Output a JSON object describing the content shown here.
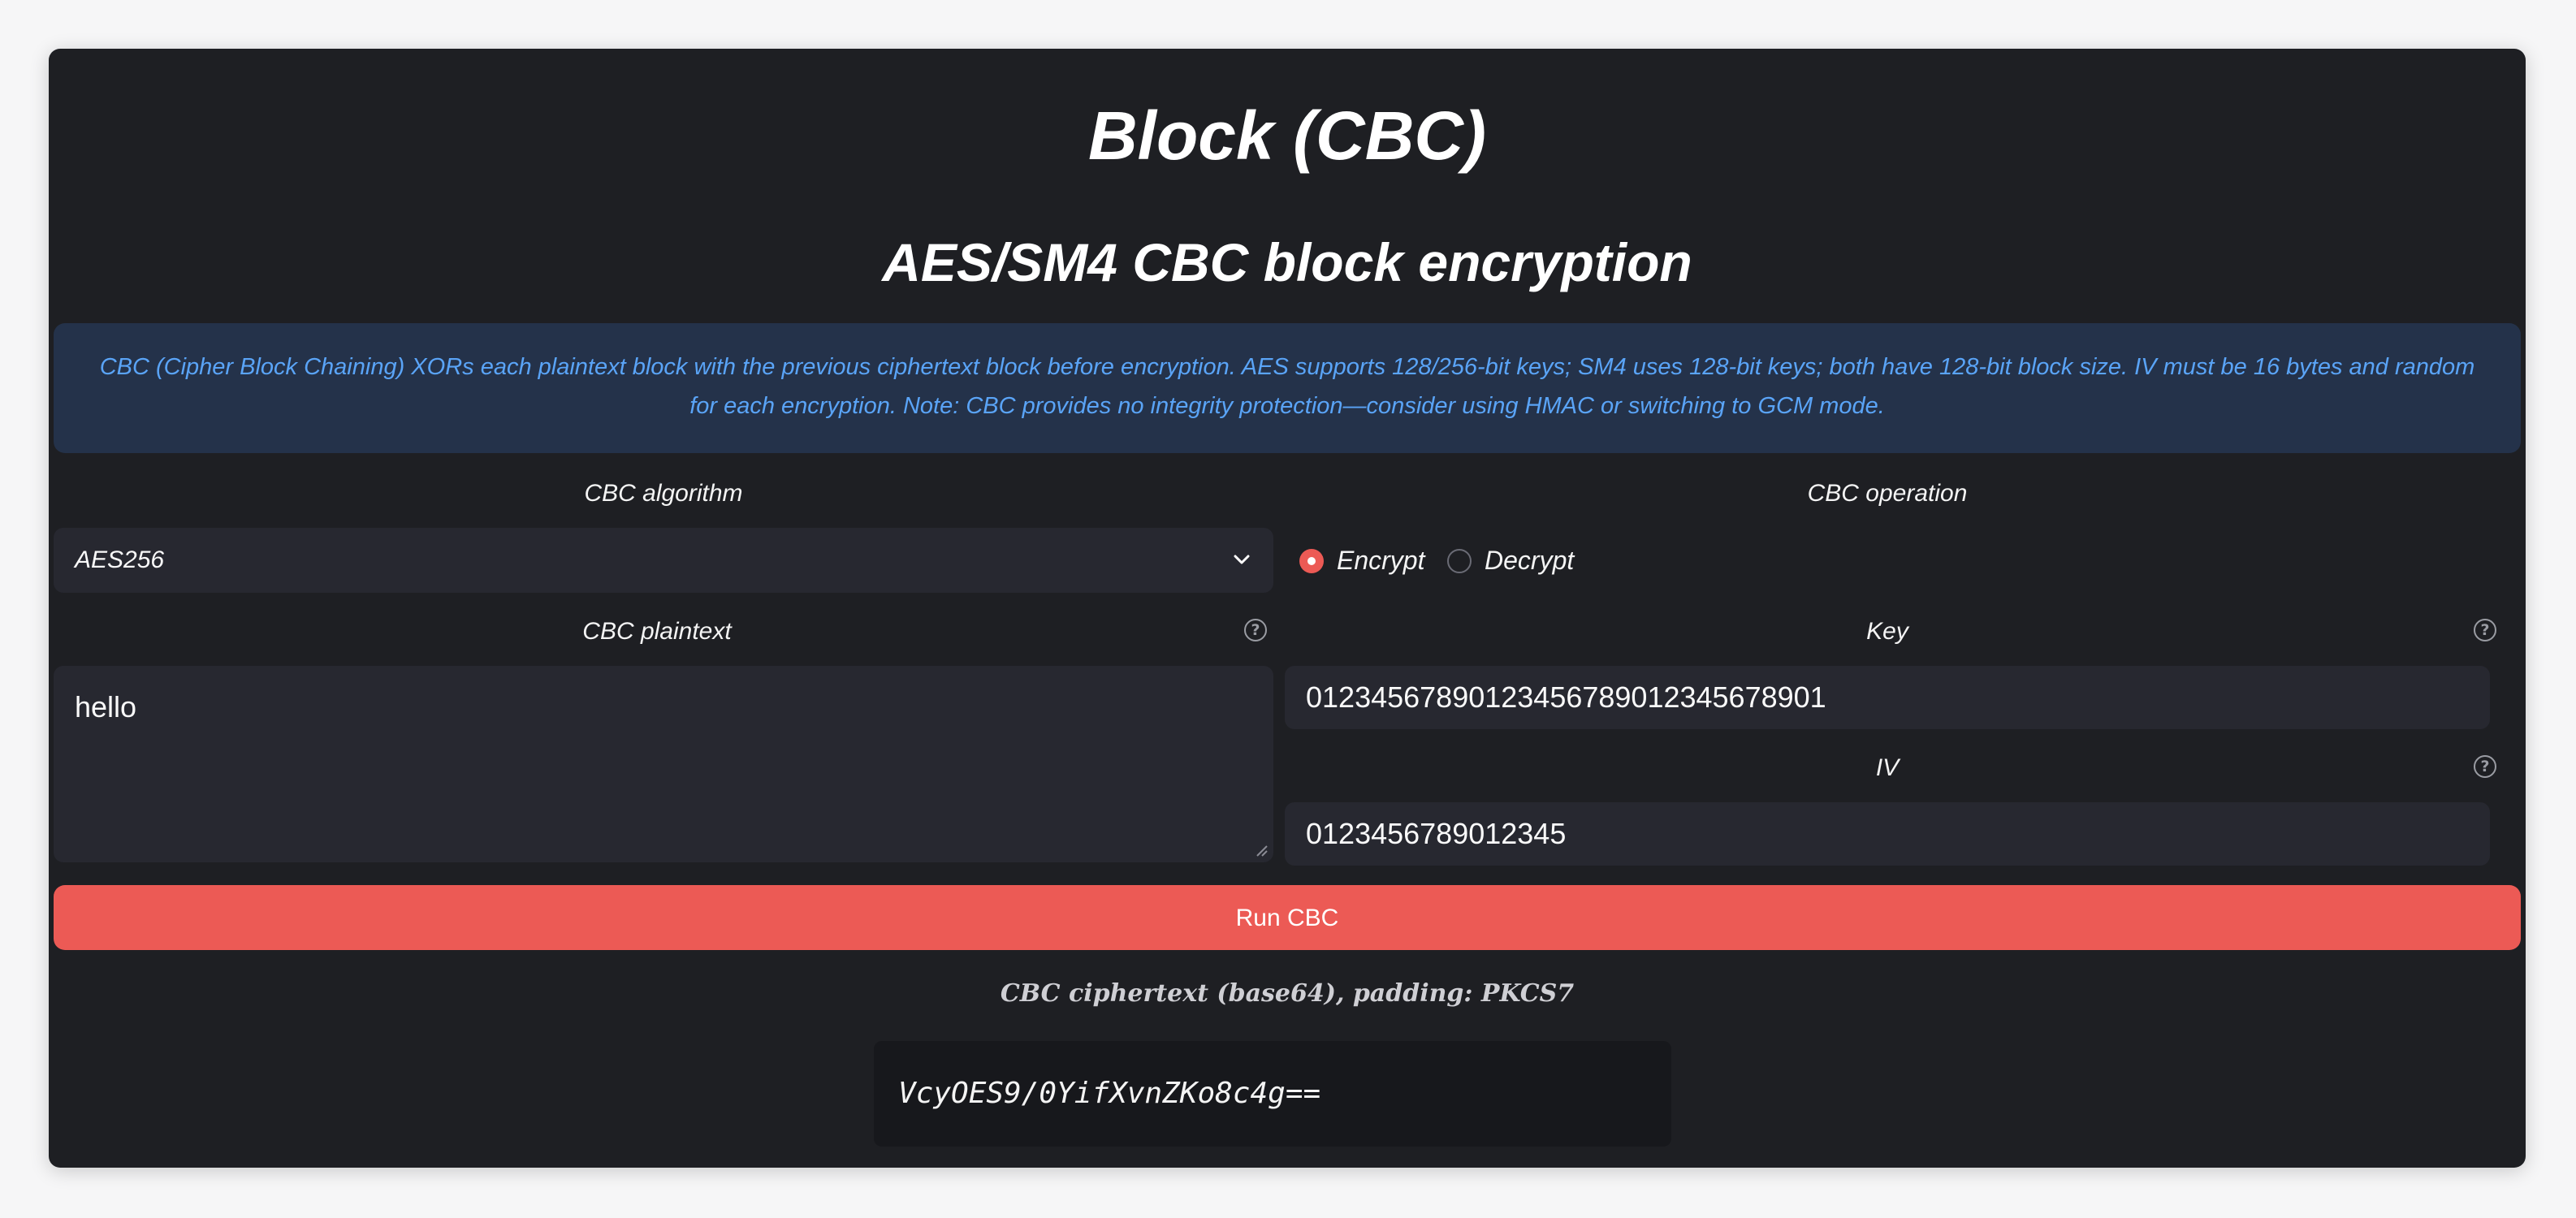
{
  "page": {
    "title": "Block (CBC)",
    "subtitle": "AES/SM4 CBC block encryption",
    "info": "CBC (Cipher Block Chaining) XORs each plaintext block with the previous ciphertext block before encryption. AES supports 128/256-bit keys; SM4 uses 128-bit keys; both have 128-bit block size. IV must be 16 bytes and random for each encryption. Note: CBC provides no integrity protection—consider using HMAC or switching to GCM mode."
  },
  "algorithm": {
    "label": "CBC algorithm",
    "selected": "AES256",
    "icon": "chevron-down-icon"
  },
  "operation": {
    "label": "CBC operation",
    "options": [
      {
        "label": "Encrypt",
        "selected": true
      },
      {
        "label": "Decrypt",
        "selected": false
      }
    ]
  },
  "plaintext": {
    "label": "CBC plaintext",
    "value": "hello",
    "help_icon": "help-circle-icon"
  },
  "key": {
    "label": "Key",
    "value": "01234567890123456789012345678901",
    "help_icon": "help-circle-icon"
  },
  "iv": {
    "label": "IV",
    "value": "0123456789012345",
    "help_icon": "help-circle-icon"
  },
  "run_button": {
    "label": "Run CBC"
  },
  "output": {
    "caption": "CBC ciphertext (base64), padding: PKCS7",
    "value": "VcyOES9/0YifXvnZKo8c4g=="
  },
  "colors": {
    "accent": "#ec5a55",
    "panel": "#1e1f23",
    "info_bg": "#24324a",
    "info_text": "#5aa4f7"
  }
}
